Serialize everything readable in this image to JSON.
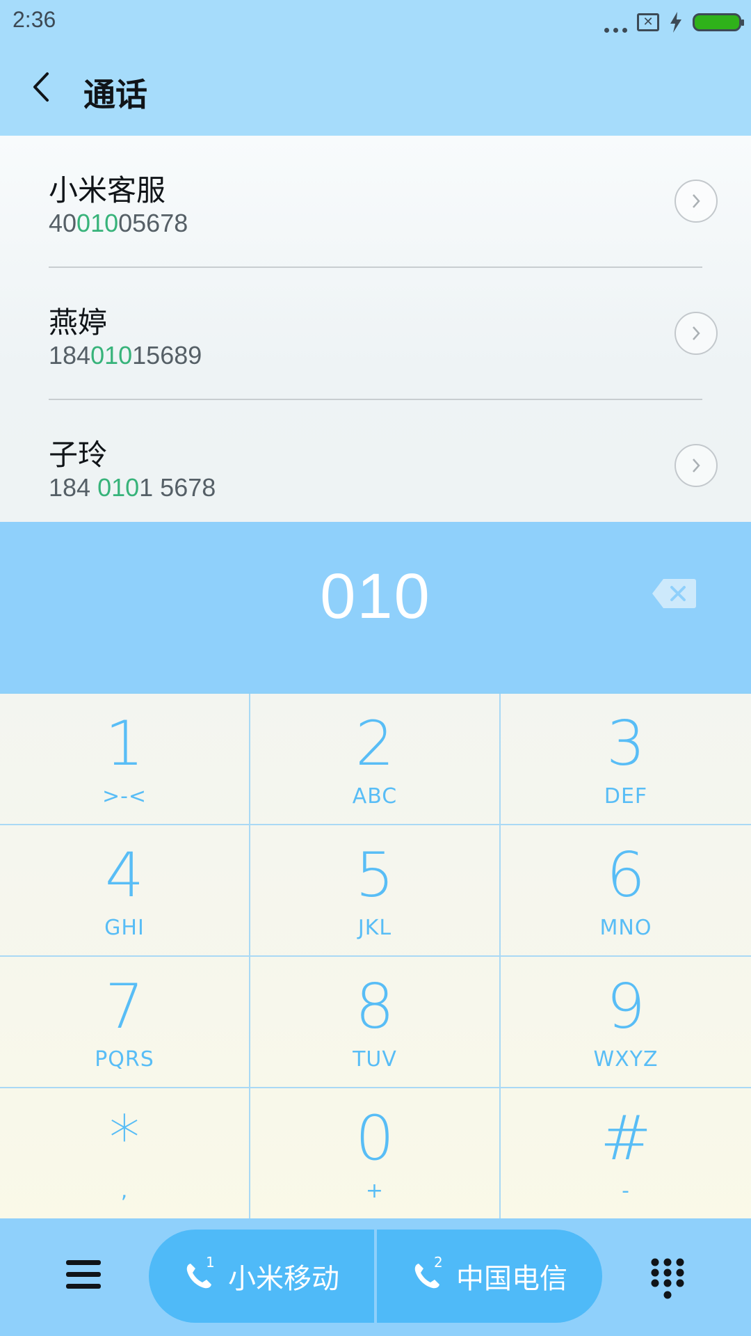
{
  "status_bar": {
    "time": "2:36"
  },
  "header": {
    "title": "通话"
  },
  "contacts": [
    {
      "name": "小米客服",
      "number_pre": "40",
      "number_hl": "010",
      "number_post": "05678"
    },
    {
      "name": "燕婷",
      "number_pre": "184",
      "number_hl": "010",
      "number_post": "15689"
    },
    {
      "name": "子玲",
      "number_pre": "184 ",
      "number_hl": "010",
      "number_post": "1 5678"
    }
  ],
  "dial_input": {
    "value": "010"
  },
  "keypad": [
    {
      "digit": "1",
      "letters": ">-<"
    },
    {
      "digit": "2",
      "letters": "ABC"
    },
    {
      "digit": "3",
      "letters": "DEF"
    },
    {
      "digit": "4",
      "letters": "GHI"
    },
    {
      "digit": "5",
      "letters": "JKL"
    },
    {
      "digit": "6",
      "letters": "MNO"
    },
    {
      "digit": "7",
      "letters": "PQRS"
    },
    {
      "digit": "8",
      "letters": "TUV"
    },
    {
      "digit": "9",
      "letters": "WXYZ"
    },
    {
      "digit": "*",
      "letters": ","
    },
    {
      "digit": "0",
      "letters": "+"
    },
    {
      "digit": "#",
      "letters": "-"
    }
  ],
  "bottom_bar": {
    "sim1": {
      "index": "1",
      "label": "小米移动"
    },
    "sim2": {
      "index": "2",
      "label": "中国电信"
    }
  },
  "colors": {
    "accent": "#58bdf6",
    "highlight": "#37b37a",
    "header_bg": "#a6dcfb",
    "display_bg": "#8fd0fb",
    "call_button": "#4fbaf8"
  }
}
